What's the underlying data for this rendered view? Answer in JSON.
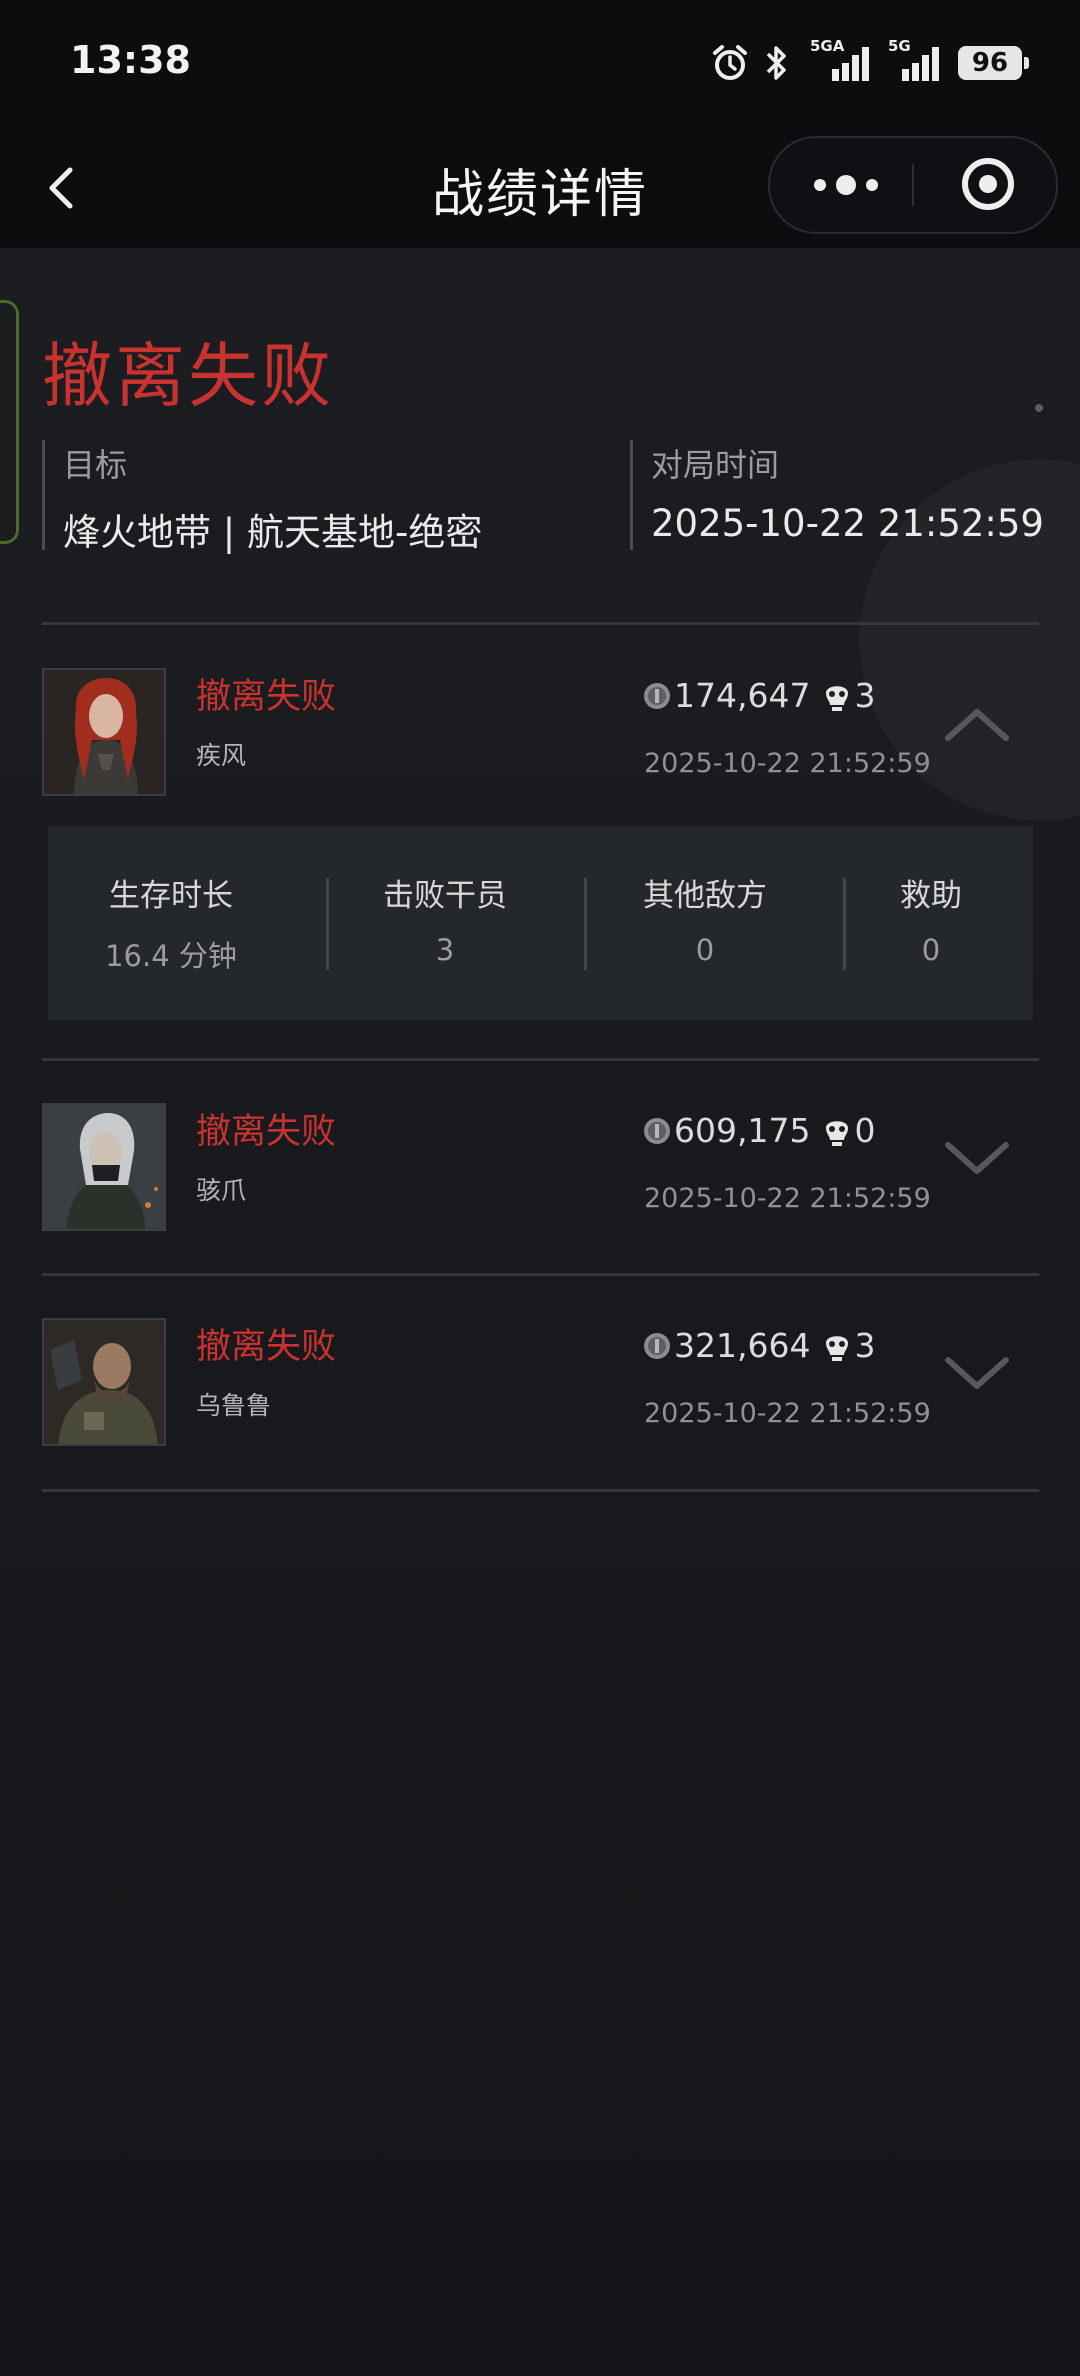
{
  "status_bar": {
    "time": "13:38",
    "network_1": "5GA",
    "network_2": "5G",
    "battery": "96",
    "icons": [
      "alarm-icon",
      "bluetooth-icon",
      "signal-5ga-icon",
      "signal-5g-icon",
      "battery-icon"
    ]
  },
  "nav": {
    "title": "战绩详情",
    "icons": [
      "back-icon",
      "more-icon",
      "target-icon"
    ]
  },
  "summary": {
    "result": "撤离失败",
    "target_label": "目标",
    "target_value": "烽火地带 | 航天基地-绝密",
    "time_label": "对局时间",
    "time_value": "2025-10-22 21:52:59"
  },
  "players": [
    {
      "status": "撤离失败",
      "name": "疾风",
      "value": "174,647",
      "kills": "3",
      "date": "2025-10-22 21:52:59",
      "expanded": true,
      "details": [
        {
          "label": "生存时长",
          "value": "16.4 分钟"
        },
        {
          "label": "击败干员",
          "value": "3"
        },
        {
          "label": "其他敌方",
          "value": "0"
        },
        {
          "label": "救助",
          "value": "0"
        }
      ]
    },
    {
      "status": "撤离失败",
      "name": "骇爪",
      "value": "609,175",
      "kills": "0",
      "date": "2025-10-22 21:52:59",
      "expanded": false
    },
    {
      "status": "撤离失败",
      "name": "乌鲁鲁",
      "value": "321,664",
      "kills": "3",
      "date": "2025-10-22 21:52:59",
      "expanded": false
    }
  ],
  "colors": {
    "fail_red": "#c8322f",
    "background": "#181a1e",
    "bar_black": "#0b0d0f"
  }
}
